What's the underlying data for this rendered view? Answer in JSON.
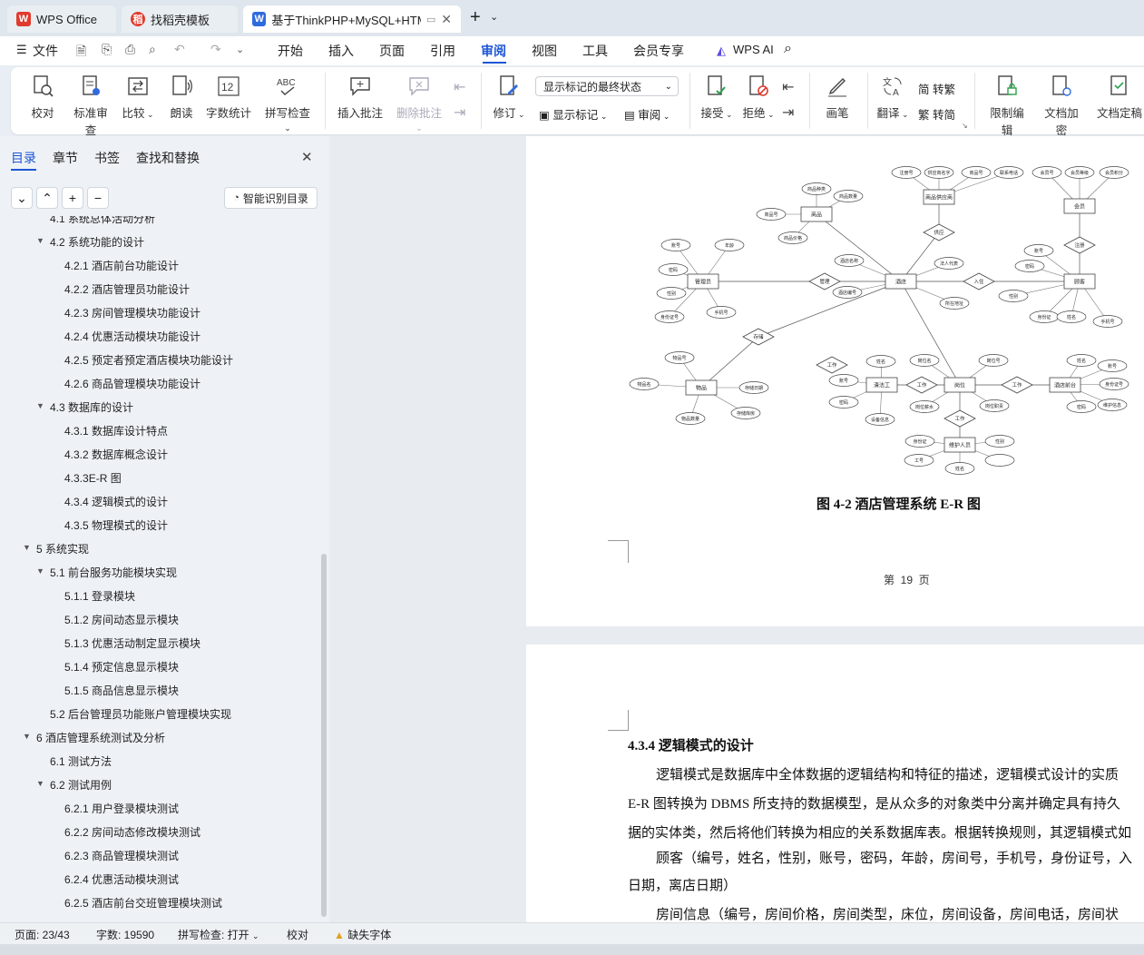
{
  "tabs": [
    {
      "label": "WPS Office",
      "icon": "wps-logo-icon"
    },
    {
      "label": "找稻壳模板",
      "icon": "docer-logo-icon"
    },
    {
      "label": "基于ThinkPHP+MySQL+HTM",
      "icon": "word-doc-icon"
    }
  ],
  "menu": {
    "file": "文件",
    "items": [
      "开始",
      "插入",
      "页面",
      "引用",
      "审阅",
      "视图",
      "工具",
      "会员专享"
    ],
    "active": "审阅",
    "wps_ai": "WPS AI"
  },
  "ribbon": {
    "proofread": "校对",
    "standard_review": "标准审查",
    "compare": "比较",
    "read_aloud": "朗读",
    "word_count": "字数统计",
    "spell_check": "拼写检查",
    "insert_comment": "插入批注",
    "delete_comment": "删除批注",
    "revise": "修订",
    "display_state": "显示标记的最终状态",
    "show_markup": "显示标记",
    "review": "审阅",
    "accept": "接受",
    "reject": "拒绝",
    "pen": "画笔",
    "translate": "翻译",
    "to_traditional": "转繁",
    "to_simplified": "转简",
    "trad_char": "繁",
    "simp_char": "简",
    "restrict_edit": "限制编辑",
    "doc_encrypt": "文档加密",
    "doc_finalize": "文档定稿",
    "word_count_glyph": "12",
    "spell_glyph": "ABC"
  },
  "nav": {
    "tabs": [
      "目录",
      "章节",
      "书签",
      "查找和替换"
    ],
    "smart_button": "智能识别目录",
    "toc": [
      {
        "text": "4.1 系统总体活动分析",
        "level": 1,
        "arrow": false
      },
      {
        "text": "4.2 系统功能的设计",
        "level": 1,
        "arrow": true
      },
      {
        "text": "4.2.1 酒店前台功能设计",
        "level": 2,
        "arrow": false
      },
      {
        "text": "4.2.2 酒店管理员功能设计",
        "level": 2,
        "arrow": false
      },
      {
        "text": "4.2.3 房间管理模块功能设计",
        "level": 2,
        "arrow": false
      },
      {
        "text": "4.2.4 优惠活动模块功能设计",
        "level": 2,
        "arrow": false
      },
      {
        "text": "4.2.5 预定者预定酒店模块功能设计",
        "level": 2,
        "arrow": false
      },
      {
        "text": "4.2.6 商品管理模块功能设计",
        "level": 2,
        "arrow": false
      },
      {
        "text": "4.3 数据库的设计",
        "level": 1,
        "arrow": true
      },
      {
        "text": "4.3.1 数据库设计特点",
        "level": 2,
        "arrow": false
      },
      {
        "text": "4.3.2 数据库概念设计",
        "level": 2,
        "arrow": false
      },
      {
        "text": "4.3.3E-R 图",
        "level": 2,
        "arrow": false
      },
      {
        "text": "4.3.4 逻辑模式的设计",
        "level": 2,
        "arrow": false
      },
      {
        "text": "4.3.5 物理模式的设计",
        "level": 2,
        "arrow": false
      },
      {
        "text": "5 系统实现",
        "level": 0,
        "arrow": true
      },
      {
        "text": "5.1 前台服务功能模块实现",
        "level": 1,
        "arrow": true
      },
      {
        "text": "5.1.1 登录模块",
        "level": 2,
        "arrow": false
      },
      {
        "text": "5.1.2 房间动态显示模块",
        "level": 2,
        "arrow": false
      },
      {
        "text": "5.1.3 优惠活动制定显示模块",
        "level": 2,
        "arrow": false
      },
      {
        "text": "5.1.4 预定信息显示模块",
        "level": 2,
        "arrow": false
      },
      {
        "text": "5.1.5 商品信息显示模块",
        "level": 2,
        "arrow": false
      },
      {
        "text": "5.2 后台管理员功能账户管理模块实现",
        "level": 1,
        "arrow": false
      },
      {
        "text": "6 酒店管理系统测试及分析",
        "level": 0,
        "arrow": true
      },
      {
        "text": "6.1 测试方法",
        "level": 1,
        "arrow": false
      },
      {
        "text": "6.2 测试用例",
        "level": 1,
        "arrow": true
      },
      {
        "text": "6.2.1 用户登录模块测试",
        "level": 2,
        "arrow": false
      },
      {
        "text": "6.2.2 房间动态修改模块测试",
        "level": 2,
        "arrow": false
      },
      {
        "text": "6.2.3 商品管理模块测试",
        "level": 2,
        "arrow": false
      },
      {
        "text": "6.2.4 优惠活动模块测试",
        "level": 2,
        "arrow": false
      },
      {
        "text": "6.2.5 酒店前台交班管理模块测试",
        "level": 2,
        "arrow": false
      }
    ]
  },
  "doc": {
    "figure_caption": "图 4-2 酒店管理系统 E-R 图",
    "page_footer": "第  19  页",
    "section_heading": "4.3.4 逻辑模式的设计",
    "paragraphs": [
      "逻辑模式是数据库中全体数据的逻辑结构和特征的描述，逻辑模式设计的实质",
      "E-R 图转换为 DBMS 所支持的数据模型，是从众多的对象类中分离并确定具有持久",
      "据的实体类，然后将他们转换为相应的关系数据库表。根据转换规则，其逻辑模式如",
      "顾客（编号，姓名，性别，账号，密码，年龄，房间号，手机号，身份证号，入",
      "日期，离店日期）",
      "房间信息（编号，房间价格，房间类型，床位，房间设备，房间电话，房间状"
    ],
    "er": {
      "entities": [
        "商品",
        "管理员",
        "酒店",
        "商品供应商",
        "会员",
        "顾客",
        "物品",
        "清洁工",
        "岗位",
        "酒店前台",
        "维护人员"
      ],
      "relations": [
        "管理",
        "入住",
        "供应",
        "注册",
        "存储",
        "工作",
        "工作",
        "工作",
        "工作"
      ],
      "attributes": [
        "商品种类",
        "商品数量",
        "商品号",
        "商品价格",
        "账号",
        "年龄",
        "密码",
        "性别",
        "身份证号",
        "手机号",
        "酒店名称",
        "法人代表",
        "酒店编号",
        "所在地址",
        "注册号",
        "供应商名字",
        "商品号",
        "联系电话",
        "会员号",
        "会员等级",
        "会员积分",
        "账号",
        "密码",
        "性别",
        "身份证",
        "手机号",
        "姓名",
        "物品号",
        "物品名",
        "物品数量",
        "存储日期",
        "存储库房",
        "姓名",
        "账号",
        "密码",
        "设备信息",
        "岗位名",
        "岗位号",
        "岗位薪水",
        "岗位职责",
        "姓名",
        "账号",
        "身份证号",
        "密码",
        "维护信息",
        "身份证",
        "工号",
        "姓名",
        "性别"
      ]
    }
  },
  "status": {
    "page": "页面: 23/43",
    "words": "字数: 19590",
    "spell": "拼写检查: 打开",
    "proof": "校对",
    "missing_font": "缺失字体"
  },
  "colors": {
    "accent": "#1d55d6",
    "wps_red": "#e03b2e"
  }
}
